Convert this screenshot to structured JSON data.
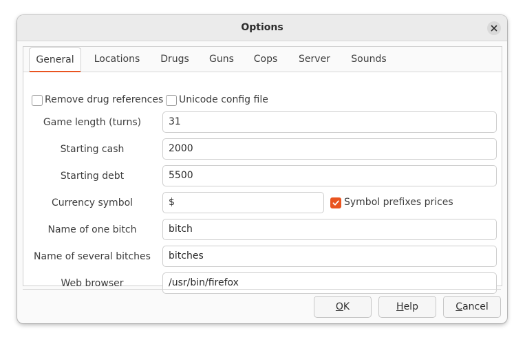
{
  "window": {
    "title": "Options"
  },
  "tabs": [
    "General",
    "Locations",
    "Drugs",
    "Guns",
    "Cops",
    "Server",
    "Sounds"
  ],
  "checkboxes": {
    "remove_drug_refs": {
      "label": "Remove drug references",
      "checked": false
    },
    "unicode_config": {
      "label": "Unicode config file",
      "checked": false
    },
    "symbol_prefixes": {
      "label": "Symbol prefixes prices",
      "checked": true
    }
  },
  "fields": {
    "game_length": {
      "label": "Game length (turns)",
      "value": "31"
    },
    "starting_cash": {
      "label": "Starting cash",
      "value": "2000"
    },
    "starting_debt": {
      "label": "Starting debt",
      "value": "5500"
    },
    "currency_symbol": {
      "label": "Currency symbol",
      "value": "$"
    },
    "name_one_bitch": {
      "label": "Name of one bitch",
      "value": "bitch"
    },
    "name_several_bitches": {
      "label": "Name of several bitches",
      "value": "bitches"
    },
    "web_browser": {
      "label": "Web browser",
      "value": "/usr/bin/firefox"
    }
  },
  "buttons": {
    "ok": {
      "mnemonic": "O",
      "rest": "K"
    },
    "help": {
      "mnemonic": "H",
      "rest": "elp"
    },
    "cancel": {
      "mnemonic": "C",
      "rest": "ancel"
    }
  },
  "colors": {
    "accent": "#e95420"
  },
  "icons": {
    "close": "close-icon",
    "check": "check-icon"
  }
}
